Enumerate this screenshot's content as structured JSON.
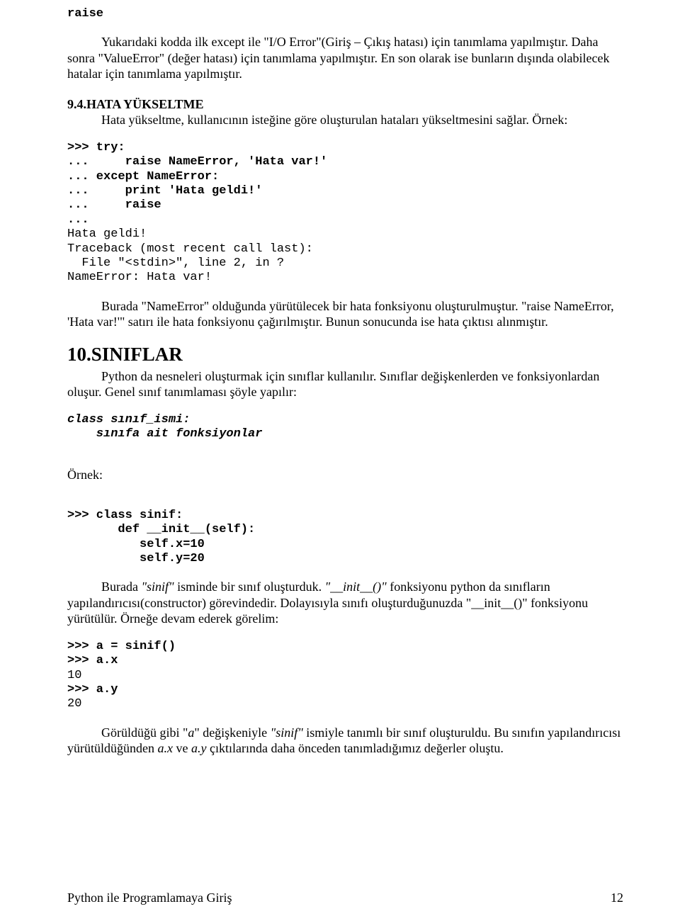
{
  "top_code": "raise",
  "p1": "Yukarıdaki kodda ilk except ile \"I/O Error\"(Giriş – Çıkış hatası) için tanımlama yapılmıştır. Daha sonra \"ValueError\" (değer hatası) için tanımlama yapılmıştır. En son olarak ise bunların dışında olabilecek hatalar için tanımlama yapılmıştır.",
  "h94": "9.4.HATA YÜKSELTME",
  "p94": "Hata yükseltme, kullanıcının isteğine göre oluşturulan hataları yükseltmesini sağlar. Örnek:",
  "code94a": ">>> try:\n...     raise NameError, 'Hata var!'\n... except NameError:\n...     print 'Hata geldi!'\n...     raise\n...",
  "code94b": "Hata geldi!\nTraceback (most recent call last):\n  File \"<stdin>\", line 2, in ?\nNameError: Hata var!",
  "p94b": "Burada \"NameError\" olduğunda yürütülecek bir hata fonksiyonu oluşturulmuştur. \"raise NameError, 'Hata var!'\" satırı ile hata fonksiyonu çağırılmıştır. Bunun sonucunda ise hata çıktısı alınmıştır.",
  "h10": "10.SINIFLAR",
  "p10a": "Python da nesneleri oluşturmak için sınıflar kullanılır. Sınıflar değişkenlerden ve fonksiyonlardan oluşur. Genel sınıf tanımlaması şöyle yapılır:",
  "code10a": "class sınıf_ismi:\n    sınıfa ait fonksiyonlar",
  "ornek": "Örnek:",
  "code10b": ">>> class sinif:\n       def __init__(self):\n          self.x=10\n          self.y=20",
  "p10b_1": "Burada ",
  "p10b_2": "\"sinif\"",
  "p10b_3": " isminde bir sınıf oluşturduk. ",
  "p10b_4": "\"__init__()\"",
  "p10b_5": " fonksiyonu python da sınıfların yapılandırıcısı(constructor) görevindedir. Dolayısıyla sınıfı oluşturduğunuzda \"__init__()\" fonksiyonu yürütülür. Örneğe devam ederek görelim:",
  "code10c_a": ">>> a = sinif()\n>>> a.x",
  "code10c_b": "10",
  "code10c_c": ">>> a.y",
  "code10c_d": "20",
  "p10c_1": "Görüldüğü gibi \"",
  "p10c_2": "a",
  "p10c_3": "\" değişkeniyle ",
  "p10c_4": "\"sinif\"",
  "p10c_5": " ismiyle tanımlı bir sınıf oluşturuldu. Bu sınıfın yapılandırıcısı yürütüldüğünden ",
  "p10c_6": "a.x",
  "p10c_7": " ve ",
  "p10c_8": "a.y",
  "p10c_9": " çıktılarında daha önceden tanımladığımız değerler oluştu.",
  "footer_left": "Python ile Programlamaya Giriş",
  "footer_right": "12"
}
